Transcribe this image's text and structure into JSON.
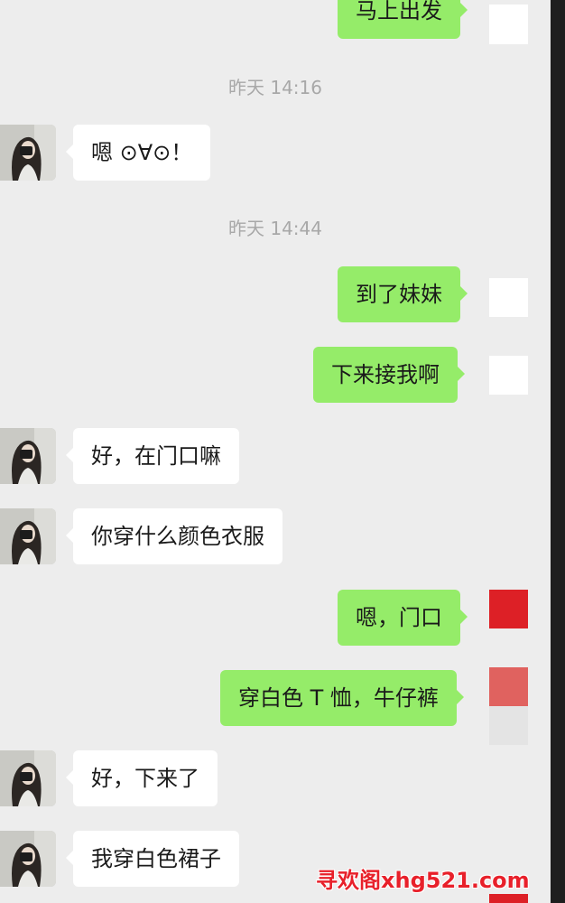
{
  "timestamps": [
    "昨天 14:16",
    "昨天 14:44"
  ],
  "messages": [
    {
      "side": "out",
      "text": "马上出发"
    },
    {
      "side": "in",
      "text": "嗯 ⊙∀⊙！"
    },
    {
      "side": "out",
      "text": "到了妹妹"
    },
    {
      "side": "out",
      "text": "下来接我啊"
    },
    {
      "side": "in",
      "text": "好，在门口嘛"
    },
    {
      "side": "in",
      "text": "你穿什么颜色衣服"
    },
    {
      "side": "out",
      "text": "嗯，门口"
    },
    {
      "side": "out",
      "text": "穿白色 T 恤，牛仔裤"
    },
    {
      "side": "in",
      "text": "好，下来了"
    },
    {
      "side": "in",
      "text": "我穿白色裙子"
    }
  ],
  "watermark": "寻欢阁xhg521.com",
  "colors": {
    "background": "#ededed",
    "outgoing_bubble": "#95ec69",
    "incoming_bubble": "#ffffff",
    "timestamp": "#a8a8a8",
    "self_avatar_white": "#ffffff",
    "self_avatar_red": "#dd2026",
    "self_avatar_light_red": "#e0625f",
    "watermark": "#e8202a"
  }
}
